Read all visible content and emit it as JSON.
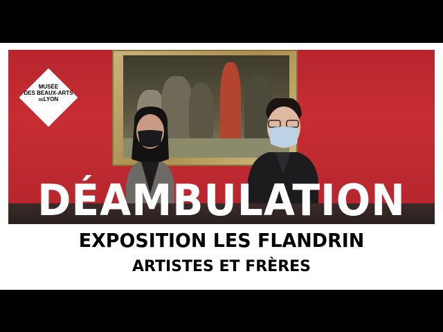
{
  "logo": {
    "line1": "MUSÉE",
    "line2": "DES BEAUX-ARTS",
    "line3": "LYON",
    "prefix": "DE"
  },
  "headline": "DÉAMBULATION",
  "subtitle": {
    "line1": "EXPOSITION LES FLANDRIN",
    "line2": "ARTISTES ET FRÈRES"
  },
  "colors": {
    "wall": "#c72d33",
    "letterbox": "#000000",
    "banner": "#ffffff"
  }
}
